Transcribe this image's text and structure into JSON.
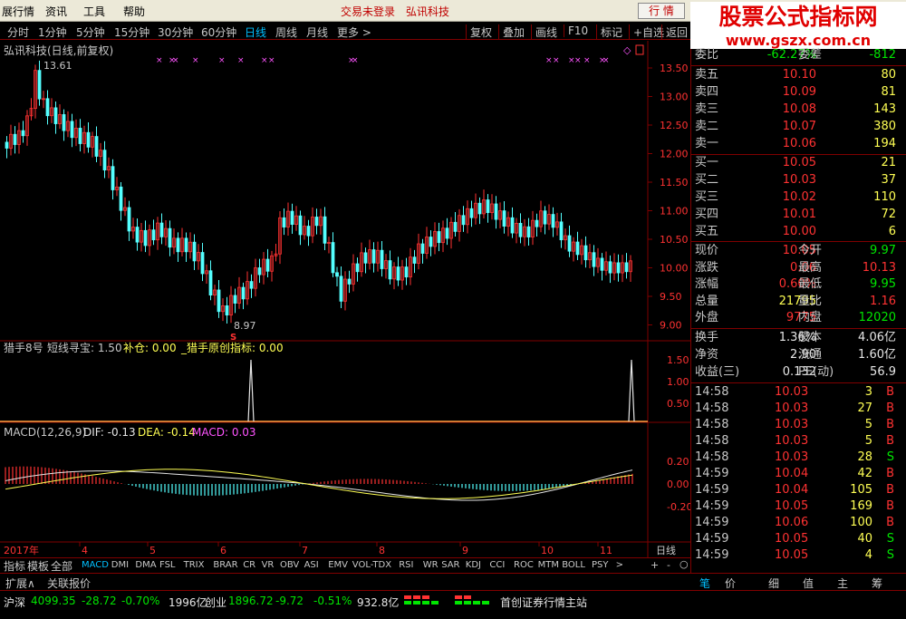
{
  "menu": {
    "items": [
      "展行情",
      "资讯",
      "工具",
      "帮助"
    ],
    "login_status": "交易未登录",
    "stock_name": "弘讯科技",
    "hq_button": "行 情"
  },
  "watermark": {
    "line1": "股票公式指标网",
    "line2": "www.gszx.com.cn"
  },
  "toolbar": {
    "periods": [
      "分时",
      "1分钟",
      "5分钟",
      "15分钟",
      "30分钟",
      "60分钟",
      "日线",
      "周线",
      "月线",
      "更多 >"
    ],
    "active": "日线",
    "buttons": [
      "复权",
      "叠加",
      "画线",
      "F10",
      "标记",
      "+自选",
      "返回"
    ]
  },
  "main_chart": {
    "title": "弘讯科技(日线,前复权)",
    "high_label": "13.61",
    "low_label": "8.97",
    "axis": [
      "13.50",
      "13.00",
      "12.50",
      "12.00",
      "11.50",
      "11.00",
      "10.50",
      "10.00",
      "9.50",
      "9.00"
    ]
  },
  "indicator1": {
    "name": "猎手8号",
    "l1": "短线寻宝: 1.50",
    "l2": "补仓: 0.00",
    "l3": "_猎手原创指标: 0.00",
    "axis": [
      "1.50",
      "1.00",
      "0.50"
    ]
  },
  "macd": {
    "name": "MACD(12,26,9)",
    "dif": "DIF: -0.13",
    "dea": "DEA: -0.14",
    "macd": "MACD: 0.03",
    "axis": [
      "0.20",
      "0.00",
      "-0.20"
    ]
  },
  "x_axis": {
    "year": "2017年",
    "months": [
      "4",
      "5",
      "6",
      "7",
      "8",
      "9",
      "10",
      "11"
    ],
    "right": "日线"
  },
  "quote": {
    "header": {
      "l": "委比",
      "v": "-62.27%",
      "l2": "委差",
      "r": "-812"
    },
    "asks": [
      {
        "l": "卖五",
        "p": "10.10",
        "q": "80"
      },
      {
        "l": "卖四",
        "p": "10.09",
        "q": "81"
      },
      {
        "l": "卖三",
        "p": "10.08",
        "q": "143"
      },
      {
        "l": "卖二",
        "p": "10.07",
        "q": "380"
      },
      {
        "l": "卖一",
        "p": "10.06",
        "q": "194"
      }
    ],
    "bids": [
      {
        "l": "买一",
        "p": "10.05",
        "q": "21"
      },
      {
        "l": "买二",
        "p": "10.03",
        "q": "37"
      },
      {
        "l": "买三",
        "p": "10.02",
        "q": "110"
      },
      {
        "l": "买四",
        "p": "10.01",
        "q": "72"
      },
      {
        "l": "买五",
        "p": "10.00",
        "q": "6"
      }
    ],
    "stats": [
      {
        "l": "现价",
        "v": "10.05",
        "l2": "今开",
        "r": "9.97"
      },
      {
        "l": "涨跌",
        "v": "0.06",
        "l2": "最高",
        "r": "10.13"
      },
      {
        "l": "涨幅",
        "v": "0.60%",
        "l2": "最低",
        "r": "9.95"
      },
      {
        "l": "总量",
        "v": "21795",
        "l2": "量比",
        "r": "1.16"
      },
      {
        "l": "外盘",
        "v": "9775",
        "l2": "内盘",
        "r": "12020"
      }
    ],
    "stats2": [
      {
        "l": "换手",
        "v": "1.36%",
        "l2": "股本",
        "r": "4.06亿"
      },
      {
        "l": "净资",
        "v": "2.90",
        "l2": "流通",
        "r": "1.60亿"
      },
      {
        "l": "收益(三)",
        "v": "0.132",
        "l2": "PE(动)",
        "r": "56.9"
      }
    ],
    "ticks": [
      {
        "t": "14:58",
        "p": "10.03",
        "q": "3",
        "d": "B"
      },
      {
        "t": "14:58",
        "p": "10.03",
        "q": "27",
        "d": "B"
      },
      {
        "t": "14:58",
        "p": "10.03",
        "q": "5",
        "d": "B"
      },
      {
        "t": "14:58",
        "p": "10.03",
        "q": "5",
        "d": "B"
      },
      {
        "t": "14:58",
        "p": "10.03",
        "q": "28",
        "d": "S"
      },
      {
        "t": "14:59",
        "p": "10.04",
        "q": "42",
        "d": "B"
      },
      {
        "t": "14:59",
        "p": "10.04",
        "q": "105",
        "d": "B"
      },
      {
        "t": "14:59",
        "p": "10.05",
        "q": "169",
        "d": "B"
      },
      {
        "t": "14:59",
        "p": "10.06",
        "q": "100",
        "d": "B"
      },
      {
        "t": "14:59",
        "p": "10.05",
        "q": "40",
        "d": "S"
      },
      {
        "t": "14:59",
        "p": "10.05",
        "q": "4",
        "d": "S"
      }
    ]
  },
  "indicator_tabs": [
    "指标",
    "模板",
    "全部",
    "MACD",
    "DMI",
    "DMA",
    "FSL",
    "TRIX",
    "BRAR",
    "CR",
    "VR",
    "OBV",
    "ASI",
    "EMV",
    "VOL-TDX",
    "RSI",
    "WR",
    "SAR",
    "KDJ",
    "CCI",
    "ROC",
    "MTM",
    "BOLL",
    "PSY",
    ">"
  ],
  "active_tab": "MACD",
  "bottom_tabs": {
    "left": [
      "扩展∧",
      "关联报价"
    ],
    "right": [
      "笔",
      "价",
      "细",
      "值",
      "主",
      "筹"
    ]
  },
  "status_bar": {
    "sh_label": "沪深",
    "sh_val": "4099.35",
    "sh_chg": "-28.72",
    "sh_pct": "-0.70%",
    "sh_amt": "1996亿",
    "cy_label": "创业",
    "cy_val": "1896.72",
    "cy_chg": "-9.72",
    "cy_pct": "-0.51%",
    "cy_amt": "932.8亿",
    "broker": "首创证券行情主站"
  }
}
